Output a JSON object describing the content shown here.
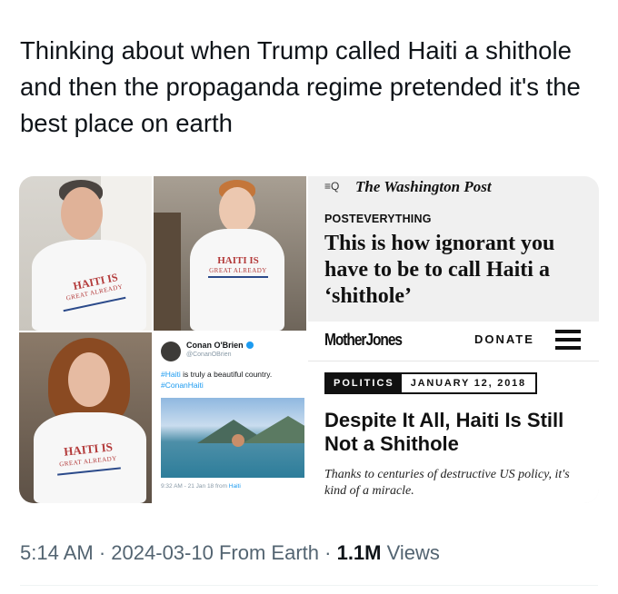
{
  "tweet": {
    "text": "Thinking about when Trump called Haiti a shithole and then the propaganda regime pretended it's the best place on earth",
    "time": "5:14 AM",
    "date": "2024-03-10",
    "source": "From Earth",
    "views_count": "1.1M",
    "views_label": "Views",
    "separator": "·"
  },
  "media": {
    "shirt": {
      "line1": "HAITI IS",
      "line2": "GREAT ALREADY"
    },
    "embedded_tweet": {
      "name": "Conan O'Brien",
      "handle": "@ConanOBrien",
      "hashtag": "#Haiti",
      "text": " is truly a beautiful country.",
      "hashtag2": "#ConanHaiti",
      "meta": "9:32 AM - 21 Jan 18 from ",
      "meta_source": "Haiti"
    },
    "wapo": {
      "menu_icon": "≡Q",
      "logo": "The Washington Post",
      "section": "POSTEVERYTHING",
      "headline": "This is how ignorant you have to be to call Haiti a ‘shithole’"
    },
    "mother_jones": {
      "logo": "MotherJones",
      "donate": "DONATE",
      "tag": "POLITICS",
      "date": "JANUARY 12, 2018",
      "headline": "Despite It All, Haiti Is Still Not a Shithole",
      "dek": "Thanks to centuries of destructive US policy, it's kind of a miracle."
    }
  },
  "colors": {
    "text_primary": "#0f1419",
    "text_secondary": "#536471",
    "shirt_red": "#b33a3a",
    "shirt_blue": "#2b4a8a",
    "link_blue": "#1d9bf0"
  }
}
